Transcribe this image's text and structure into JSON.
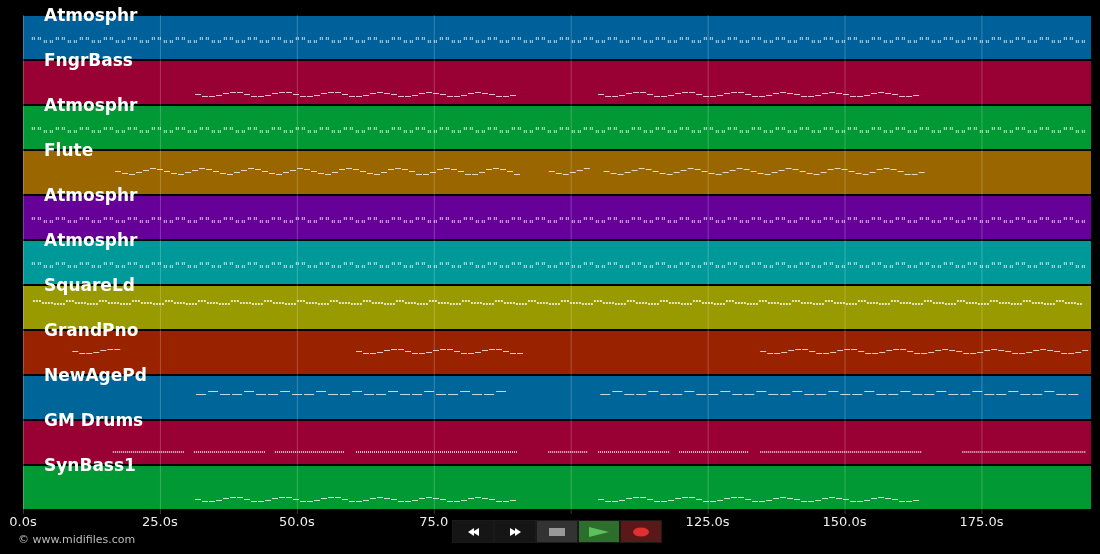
{
  "tracks": [
    {
      "name": "Atmosphr",
      "color": "#00609a",
      "kind": "chords"
    },
    {
      "name": "FngrBass",
      "color": "#990033",
      "kind": "bass"
    },
    {
      "name": "Atmosphr",
      "color": "#009933",
      "kind": "chords"
    },
    {
      "name": "Flute",
      "color": "#996600",
      "kind": "flute"
    },
    {
      "name": "Atmosphr",
      "color": "#660099",
      "kind": "chords"
    },
    {
      "name": "Atmosphr",
      "color": "#009999",
      "kind": "chords"
    },
    {
      "name": "SquareLd",
      "color": "#999900",
      "kind": "lead"
    },
    {
      "name": "GrandPno",
      "color": "#992200",
      "kind": "piano"
    },
    {
      "name": "NewAgePd",
      "color": "#006699",
      "kind": "pad"
    },
    {
      "name": "GM Drums",
      "color": "#990033",
      "kind": "drums"
    },
    {
      "name": "SynBass1",
      "color": "#009933",
      "kind": "bass"
    }
  ],
  "time_axis": {
    "ticks": [
      {
        "kind": "label",
        "label": "0.0s"
      },
      {
        "kind": "label",
        "label": "25.0s"
      },
      {
        "kind": "label",
        "label": "50.0s"
      },
      {
        "kind": "label",
        "label": "75.0"
      },
      {
        "kind": "covered"
      },
      {
        "kind": "label",
        "label": "125.0s"
      },
      {
        "kind": "label",
        "label": "150.0s"
      },
      {
        "kind": "label",
        "label": "175.0s"
      }
    ]
  },
  "transport": {
    "buttons": [
      {
        "kind": "rewind"
      },
      {
        "kind": "forward"
      },
      {
        "kind": "stop"
      },
      {
        "kind": "play"
      },
      {
        "kind": "record"
      }
    ]
  },
  "credit": "© www.midifiles.com"
}
